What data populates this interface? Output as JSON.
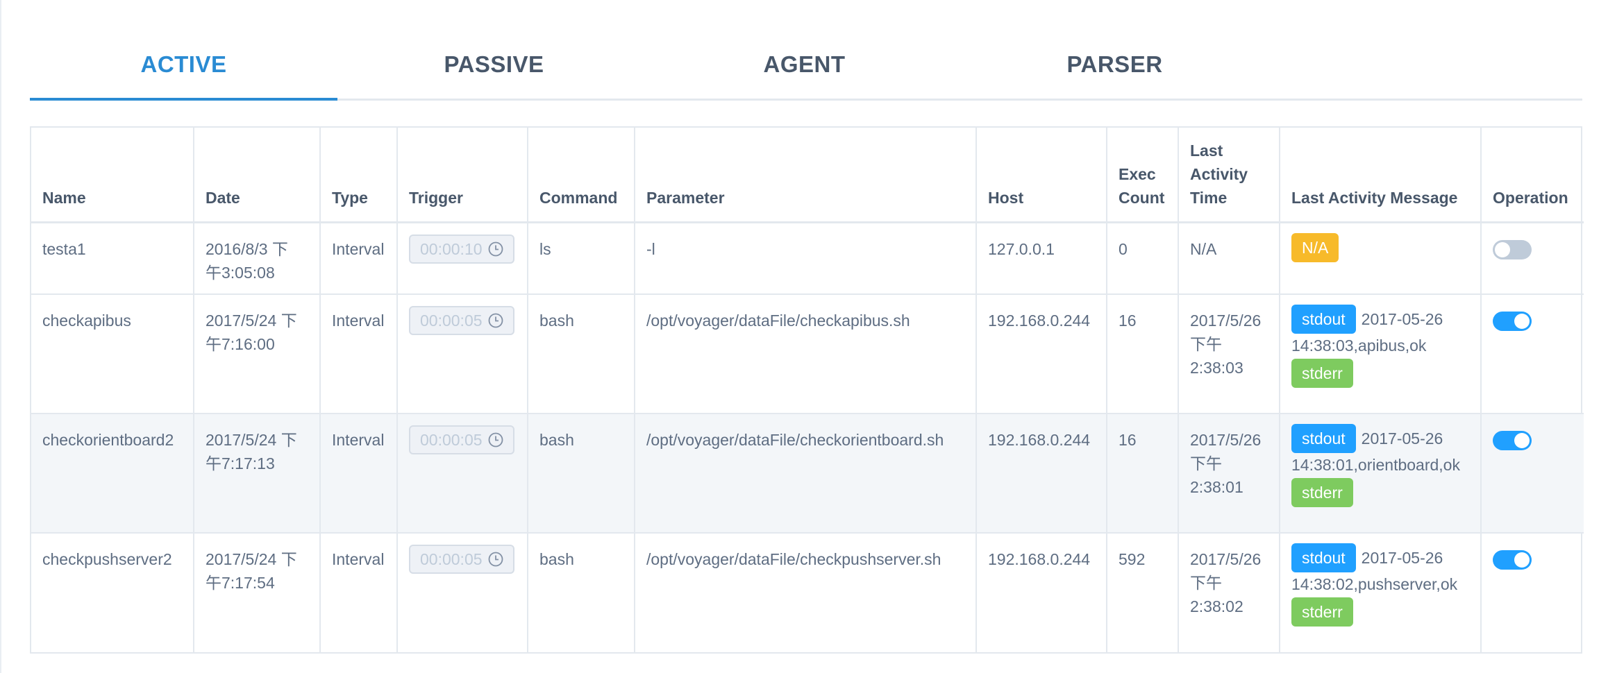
{
  "tabs": [
    {
      "label": "ACTIVE",
      "active": true
    },
    {
      "label": "PASSIVE",
      "active": false
    },
    {
      "label": "AGENT",
      "active": false
    },
    {
      "label": "PARSER",
      "active": false
    }
  ],
  "table": {
    "headers": {
      "name": "Name",
      "date": "Date",
      "type": "Type",
      "trigger": "Trigger",
      "command": "Command",
      "parameter": "Parameter",
      "host": "Host",
      "exec_count_1": "Exec",
      "exec_count_2": "Count",
      "last_time_1": "Last",
      "last_time_2": "Activity",
      "last_time_3": "Time",
      "last_message": "Last Activity Message",
      "operation": "Operation"
    },
    "rows": [
      {
        "name": "testa1",
        "date_1": "2016/8/3 下",
        "date_2": "午3:05:08",
        "type": "Interval",
        "trigger": "00:00:10",
        "command": "ls",
        "parameter": "-l",
        "host": "127.0.0.1",
        "exec_count": "0",
        "last_time": "N/A",
        "tag": "N/A",
        "enabled": false
      },
      {
        "name": "checkapibus",
        "date_1": "2017/5/24 下",
        "date_2": "午7:16:00",
        "type": "Interval",
        "trigger": "00:00:05",
        "command": "bash",
        "parameter": "/opt/voyager/dataFile/checkapibus.sh",
        "host": "192.168.0.244",
        "exec_count": "16",
        "last_time_1": "2017/5/26",
        "last_time_2": "下午",
        "last_time_3": "2:38:03",
        "stdout_label": "stdout",
        "msg_1": "2017-05-26",
        "msg_2": "14:38:03,apibus,ok",
        "stderr_label": "stderr",
        "enabled": true
      },
      {
        "name": "checkorientboard2",
        "date_1": "2017/5/24 下",
        "date_2": "午7:17:13",
        "type": "Interval",
        "trigger": "00:00:05",
        "command": "bash",
        "parameter": "/opt/voyager/dataFile/checkorientboard.sh",
        "host": "192.168.0.244",
        "exec_count": "16",
        "last_time_1": "2017/5/26",
        "last_time_2": "下午",
        "last_time_3": "2:38:01",
        "stdout_label": "stdout",
        "msg_1": "2017-05-26",
        "msg_2": "14:38:01,orientboard,ok",
        "stderr_label": "stderr",
        "enabled": true
      },
      {
        "name": "checkpushserver2",
        "date_1": "2017/5/24 下",
        "date_2": "午7:17:54",
        "type": "Interval",
        "trigger": "00:00:05",
        "command": "bash",
        "parameter": "/opt/voyager/dataFile/checkpushserver.sh",
        "host": "192.168.0.244",
        "exec_count": "592",
        "last_time_1": "2017/5/26",
        "last_time_2": "下午",
        "last_time_3": "2:38:02",
        "stdout_label": "stdout",
        "msg_1": "2017-05-26",
        "msg_2": "14:38:02,pushserver,ok",
        "stderr_label": "stderr",
        "enabled": true
      }
    ]
  },
  "colors": {
    "accent": "#2a8bd3",
    "stdout_tag": "#20a0ff",
    "stderr_tag": "#7ecb5f",
    "na_tag": "#f7ba2a",
    "switch_on": "#20a0ff",
    "switch_off": "#bfcbd9"
  },
  "icons": {
    "trigger_suffix": "clock-icon"
  }
}
